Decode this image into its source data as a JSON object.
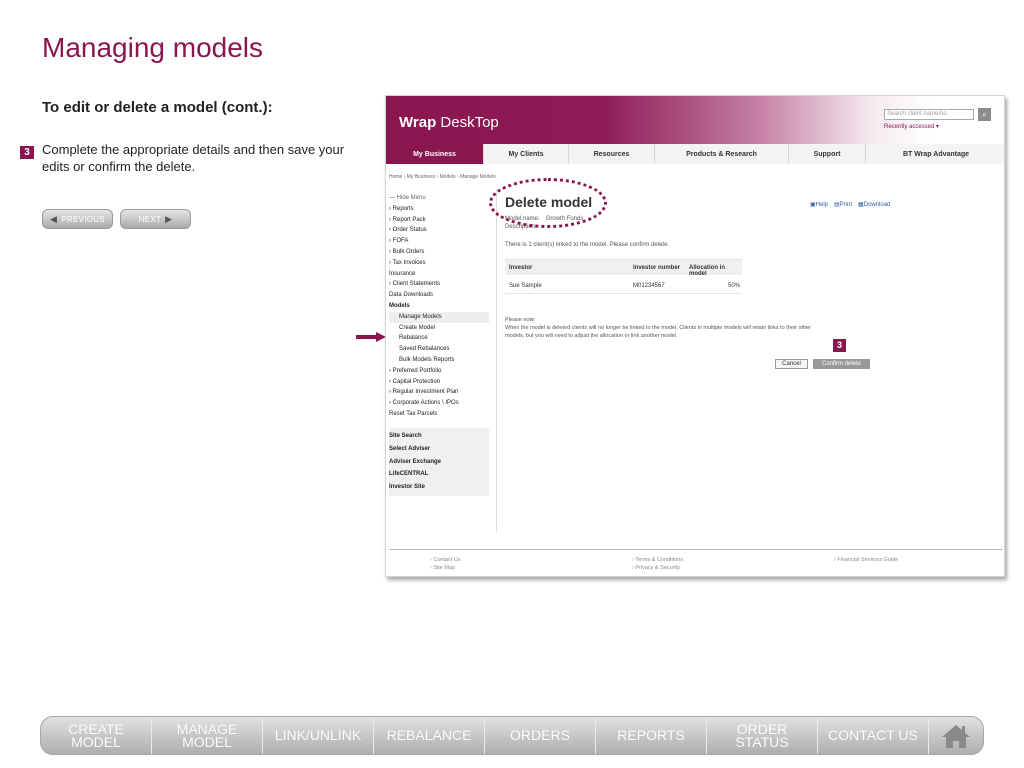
{
  "slide": {
    "title": "Managing models",
    "subtitle": "To edit or delete a model (cont.):",
    "step_number": "3",
    "step_text": "Complete the appropriate details and then save your edits or confirm the delete.",
    "prev_label": "PREVIOUS",
    "next_label": "NEXT"
  },
  "app": {
    "logo_bold": "Wrap",
    "logo_rest": " DeskTop",
    "search_placeholder": "Search client name/no.",
    "search_icon": "magnifier-icon",
    "recently_accessed": "Recently accessed ▾",
    "tabs": [
      {
        "label": "My Business",
        "active": true
      },
      {
        "label": "My Clients"
      },
      {
        "label": "Resources"
      },
      {
        "label": "Products & Research"
      },
      {
        "label": "Support"
      },
      {
        "label": "BT Wrap Advantage"
      }
    ],
    "breadcrumb": "Home  ›  My Business  ›  Models  ›  Manage Models"
  },
  "sidebar": {
    "items": [
      {
        "label": "— Hide Menu"
      },
      {
        "label": "› Reports"
      },
      {
        "label": "› Report Pack"
      },
      {
        "label": "› Order Status"
      },
      {
        "label": "› FOFA"
      },
      {
        "label": "› Bulk Orders"
      },
      {
        "label": "› Tax Invoices"
      },
      {
        "label": "Insurance"
      },
      {
        "label": "› Client Statements"
      },
      {
        "label": "Data Downloads"
      },
      {
        "label": "Models"
      },
      {
        "label": "Manage Models"
      },
      {
        "label": "Create Model"
      },
      {
        "label": "Rebalance"
      },
      {
        "label": "Saved Rebalances"
      },
      {
        "label": "Bulk Models Reports"
      },
      {
        "label": "› Preferred Portfolio"
      },
      {
        "label": "› Capital Protection"
      },
      {
        "label": "› Regular Investment Plan"
      },
      {
        "label": "› Corporate Actions \\ IPOs"
      },
      {
        "label": "Reset Tax Parcels"
      }
    ],
    "box_items": [
      {
        "label": "Site Search"
      },
      {
        "label": "Select Adviser"
      },
      {
        "label": "Adviser Exchange"
      },
      {
        "label": "LifeCENTRAL"
      },
      {
        "label": "Investor Site"
      }
    ]
  },
  "content": {
    "title": "Delete model",
    "help": "Help",
    "print": "Print",
    "download": "Download",
    "model_name_label": "Model name:",
    "model_name_value": "Growth Funds",
    "description_label": "Description:",
    "info": "There is 1 client(s) linked to the model. Please confirm delete.",
    "table": {
      "headers": [
        "Investor",
        "Investor number",
        "Allocation in model"
      ],
      "rows": [
        [
          "Sue Sample",
          "M01234567",
          "50%"
        ]
      ]
    },
    "note_title": "Please note:",
    "note_text": "When the model is deleted clients will no longer be linked to the model. Clients in multiple models will retain links to their other models, but you will need to adjust the allocation or link another model.",
    "step_marker": "3",
    "cancel": "Cancel",
    "confirm": "Confirm delete"
  },
  "footer": {
    "col1": [
      "› Contact Us",
      "› Site Map"
    ],
    "col2": [
      "› Terms & Conditions",
      "› Privacy & Security"
    ],
    "col3": [
      "› Financial Services Guide"
    ]
  },
  "bottom_nav": {
    "items": [
      "CREATE\nMODEL",
      "MANAGE\nMODEL",
      "LINK/UNLINK",
      "REBALANCE",
      "ORDERS",
      "REPORTS",
      "ORDER\nSTATUS",
      "CONTACT US"
    ],
    "home_icon": "home-icon"
  },
  "colors": {
    "accent": "#8a1650",
    "nav_grey": "#c5c5c5"
  }
}
